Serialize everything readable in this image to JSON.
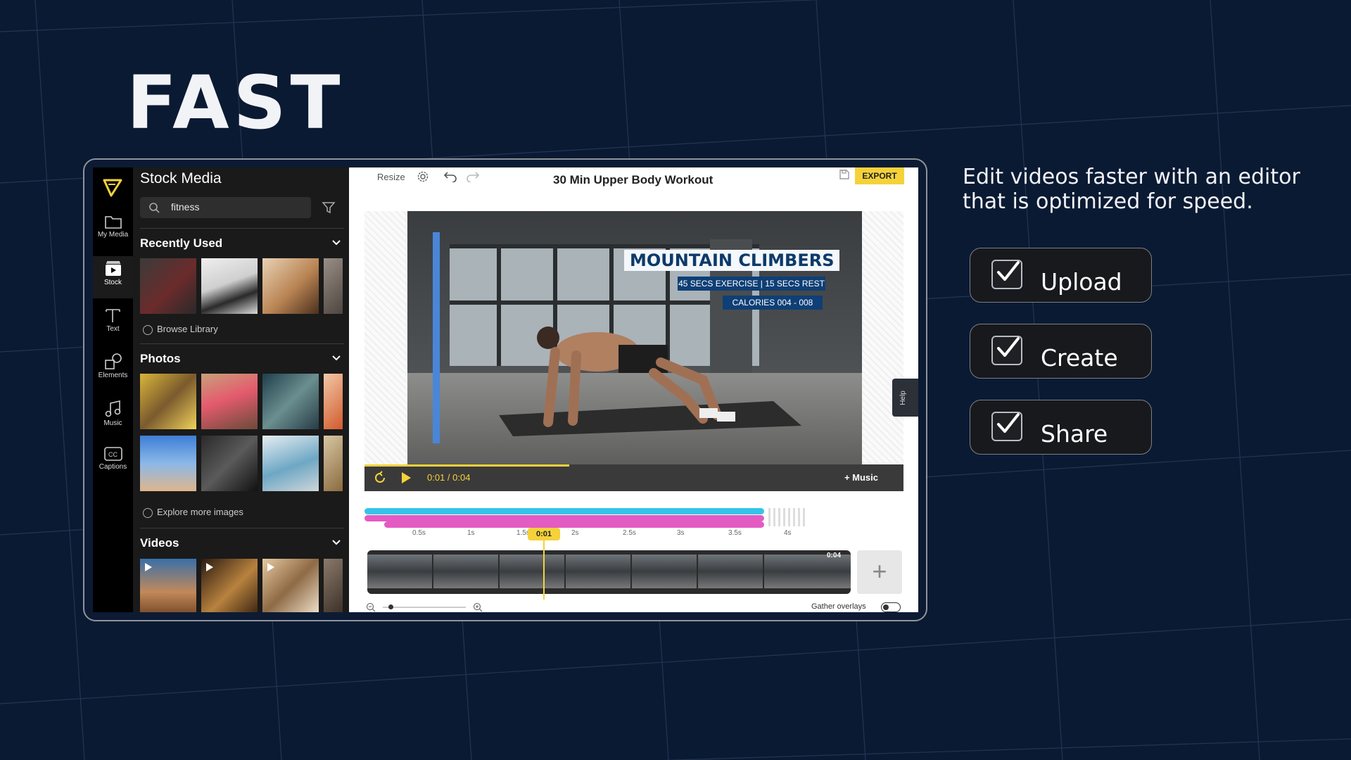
{
  "hero": {
    "title": "FAST",
    "tagline": "Edit videos faster with an editor that is optimized for speed."
  },
  "features": [
    {
      "label": "Upload",
      "checked": true
    },
    {
      "label": "Create",
      "checked": true
    },
    {
      "label": "Share",
      "checked": true
    }
  ],
  "colors": {
    "background": "#0b1a33",
    "accent": "#f5d23a",
    "track_cyan": "#35c4e8",
    "track_pink": "#e45bc3",
    "panel": "#1a1a1a",
    "overlay_blue": "#0e3f76"
  },
  "rail": {
    "items": [
      {
        "label": "My Media",
        "icon": "folder-icon"
      },
      {
        "label": "Stock",
        "icon": "stock-film-icon",
        "active": true
      },
      {
        "label": "Text",
        "icon": "text-icon"
      },
      {
        "label": "Elements",
        "icon": "shapes-icon"
      },
      {
        "label": "Music",
        "icon": "music-note-icon"
      },
      {
        "label": "Captions",
        "icon": "cc-icon"
      }
    ]
  },
  "panel": {
    "title": "Stock Media",
    "search_value": "fitness",
    "recently_used": "Recently Used",
    "browse_library": "Browse Library",
    "photos": "Photos",
    "explore_more": "Explore more images",
    "videos": "Videos"
  },
  "toolbar": {
    "resize": "Resize",
    "project_title": "30 Min Upper Body Workout",
    "export": "EXPORT",
    "help": "Help"
  },
  "video_overlay": {
    "title": "MOUNTAIN CLIMBERS",
    "subtitle": "45 SECS EXERCISE | 15 SECS REST",
    "calories": "CALORIES  004 - 008"
  },
  "player": {
    "time": "0:01 / 0:04",
    "music": "+ Music",
    "progress": 0.38
  },
  "timeline": {
    "ticks": [
      "0.5s",
      "1s",
      "1.5s",
      "2s",
      "2.5s",
      "3s",
      "3.5s",
      "4s"
    ],
    "playhead": "0:01",
    "clip_duration": "0:04",
    "gather_overlays": "Gather overlays"
  }
}
